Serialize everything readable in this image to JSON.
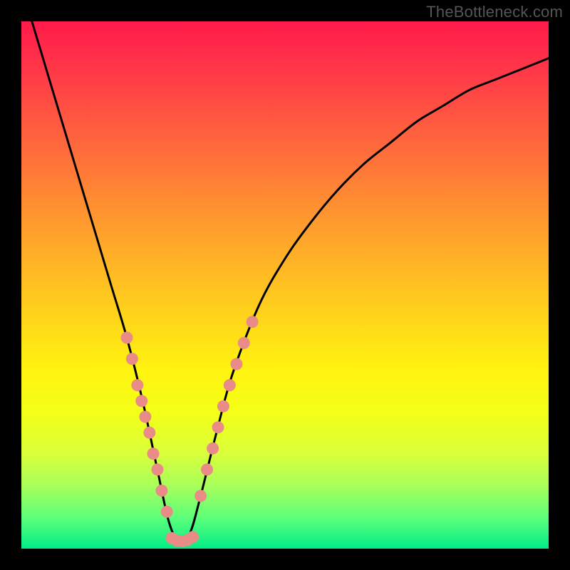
{
  "watermark": "TheBottleneck.com",
  "chart_data": {
    "type": "line",
    "title": "",
    "xlabel": "",
    "ylabel": "",
    "ylim": [
      0,
      100
    ],
    "xlim": [
      0,
      100
    ],
    "curve": {
      "comment": "V-shaped bottleneck curve; y is percent (0=bottom/green, 100=top/red). Minimum at x≈30.",
      "x": [
        2,
        5,
        8,
        11,
        14,
        17,
        20,
        23,
        26,
        28,
        30,
        32,
        34,
        37,
        40,
        45,
        50,
        55,
        60,
        65,
        70,
        75,
        80,
        85,
        90,
        95,
        100
      ],
      "y": [
        100,
        90,
        80,
        70,
        60,
        50,
        40,
        28,
        14,
        5,
        1,
        3,
        10,
        22,
        33,
        46,
        55,
        62,
        68,
        73,
        77,
        81,
        84,
        87,
        89,
        91,
        93
      ]
    },
    "series": [
      {
        "name": "left-branch-dots",
        "color": "#e98b86",
        "points": [
          {
            "x": 20.0,
            "y": 40
          },
          {
            "x": 21.0,
            "y": 36
          },
          {
            "x": 22.0,
            "y": 31
          },
          {
            "x": 22.8,
            "y": 28
          },
          {
            "x": 23.5,
            "y": 25
          },
          {
            "x": 24.3,
            "y": 22
          },
          {
            "x": 25.0,
            "y": 18
          },
          {
            "x": 25.8,
            "y": 15
          },
          {
            "x": 26.6,
            "y": 11
          },
          {
            "x": 27.6,
            "y": 7
          }
        ]
      },
      {
        "name": "right-branch-dots",
        "color": "#e98b86",
        "points": [
          {
            "x": 34.0,
            "y": 10
          },
          {
            "x": 35.2,
            "y": 15
          },
          {
            "x": 36.3,
            "y": 19
          },
          {
            "x": 37.3,
            "y": 23
          },
          {
            "x": 38.3,
            "y": 27
          },
          {
            "x": 39.5,
            "y": 31
          },
          {
            "x": 40.8,
            "y": 35
          },
          {
            "x": 42.2,
            "y": 39
          },
          {
            "x": 43.8,
            "y": 43
          }
        ]
      },
      {
        "name": "bottom-dots",
        "color": "#e98b86",
        "points": [
          {
            "x": 28.5,
            "y": 2.0
          },
          {
            "x": 29.5,
            "y": 1.5
          },
          {
            "x": 30.5,
            "y": 1.4
          },
          {
            "x": 31.5,
            "y": 1.6
          },
          {
            "x": 32.5,
            "y": 2.2
          }
        ]
      }
    ]
  }
}
